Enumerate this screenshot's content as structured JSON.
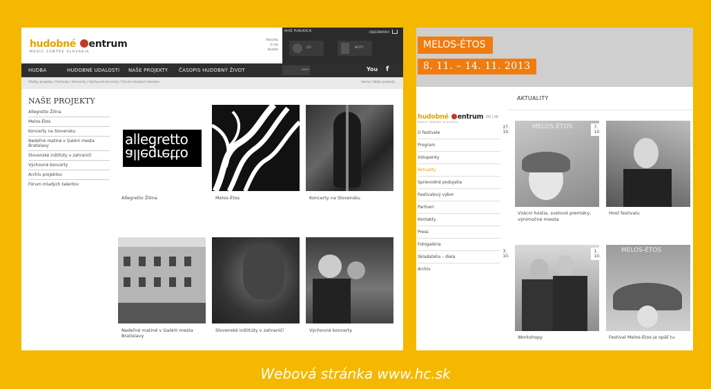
{
  "left": {
    "logo_part1": "hudobné",
    "logo_part2": "entrum",
    "logo_sub": "MUSIC CENTRE SLOVAKIA",
    "top_links": [
      "Aktuality",
      "O nás",
      "Kontakt"
    ],
    "publications": {
      "title": "NAŠE PUBLIKÁCIE",
      "cart": "OBJEDNÁVKA",
      "cd": "CD",
      "noty": "NOTY"
    },
    "nav": [
      "HUDBA",
      "HUDOBNÉ UDALOSTI",
      "NAŠE PROJEKTY",
      "ČASOPIS HUDOBNÝ ŽIVOT"
    ],
    "nav_small": "KNIHY",
    "social": {
      "youtube": "You",
      "facebook": "f"
    },
    "breadcrumb": "Všetky projekty / Festivaly / Koncerty / Výchovné koncerty / Fórum mladých talentov",
    "breadcrumb_right": "Home / Naše projekty",
    "sidebar_title": "NAŠE PROJEKTY",
    "sidebar_items": [
      "Allegretto Žilina",
      "Melos-Étos",
      "Koncerty na Slovensku",
      "Nedeľné matiné v Galérii mesta Bratislavy",
      "Slovenské inštitúty v zahraničí",
      "Výchovné koncerty",
      "Archív projektov",
      "Fórum mladých talentov"
    ],
    "allegretto_logo": "allegretto",
    "tiles": [
      "Allegretto Žilina",
      "Melos-Étos",
      "Koncerty na Slovensku",
      "Nedeľné matiné v Galérii mesta Bratislavy",
      "Slovenské inštitúty v zahraničí",
      "Výchovné koncerty"
    ]
  },
  "right": {
    "festival_title": "MELOS-ÉTOS",
    "festival_dates": "8. 11. – 14. 11. 2013",
    "section_title": "AKTUALITY",
    "logo_part1": "hudobné",
    "logo_part2": "entrum",
    "logo_sub": "MUSIC CENTRE SLOVAKIA",
    "lang": "EN | SK",
    "menu": [
      "O festivale",
      "Program",
      "Vstupenky",
      "Aktuality",
      "Sprievodné podujatia",
      "Festivalový výbor",
      "Partneri",
      "Kontakty",
      "Press",
      "Fotogaléria",
      "Skladatelia – diela",
      "Archív"
    ],
    "active_menu": "Aktuality",
    "news": [
      {
        "date": "27. 10.",
        "caption": "Vzácni hostia, svetové premiéry, výnimočné miesta",
        "overlay": "MELOS-ÉTOS"
      },
      {
        "date": "7. 10.",
        "caption": "Hosť festivalu"
      },
      {
        "date": "3. 10.",
        "caption": "Workshopy"
      },
      {
        "date": "1. 10.",
        "caption": "Festival Melos-Étos je opäť tu",
        "overlay": "MELOS-ÉTOS"
      }
    ]
  },
  "footer": "Webová stránka www.hc.sk"
}
